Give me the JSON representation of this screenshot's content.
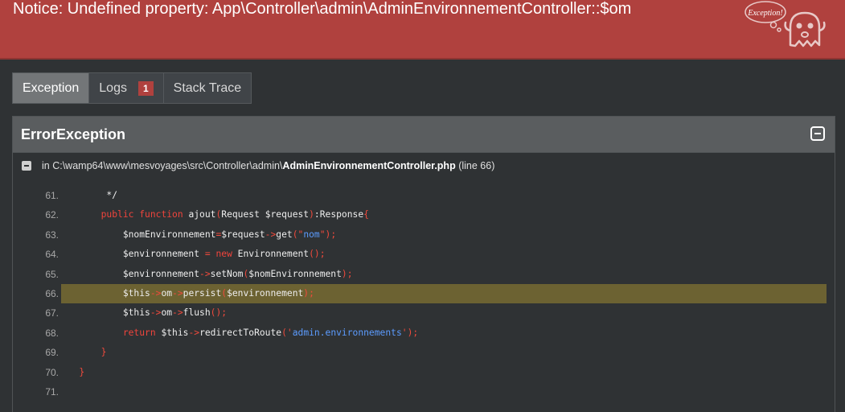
{
  "header": {
    "title": "Notice: Undefined property: App\\Controller\\admin\\AdminEnvironnementController::$om",
    "logo_text": "Exception!"
  },
  "tabs": [
    {
      "label": "Exception",
      "active": true
    },
    {
      "label": "Logs",
      "badge": "1"
    },
    {
      "label": "Stack Trace"
    }
  ],
  "panel": {
    "title": "ErrorException",
    "file": {
      "prefix": "in C:\\wamp64\\www\\mesvoyages\\src\\Controller\\admin\\",
      "name": "AdminEnvironnementController.php",
      "suffix": "(line 66)"
    }
  },
  "code": {
    "highlight_line": 66,
    "lines": [
      {
        "n": "61.",
        "text": "        */"
      },
      {
        "n": "62.",
        "text": "       public function ajout(Request $request):Response{"
      },
      {
        "n": "63.",
        "text": "           $nomEnvironnement=$request->get(\"nom\");"
      },
      {
        "n": "64.",
        "text": "           $environnement = new Environnement();"
      },
      {
        "n": "65.",
        "text": "           $environnement->setNom($nomEnvironnement);"
      },
      {
        "n": "66.",
        "text": "           $this->om->persist($environnement);"
      },
      {
        "n": "67.",
        "text": "           $this->om->flush();"
      },
      {
        "n": "68.",
        "text": "           return $this->redirectToRoute('admin.environnements');"
      },
      {
        "n": "69.",
        "text": "       }"
      },
      {
        "n": "70.",
        "text": "   }"
      },
      {
        "n": "71.",
        "text": ""
      }
    ]
  }
}
